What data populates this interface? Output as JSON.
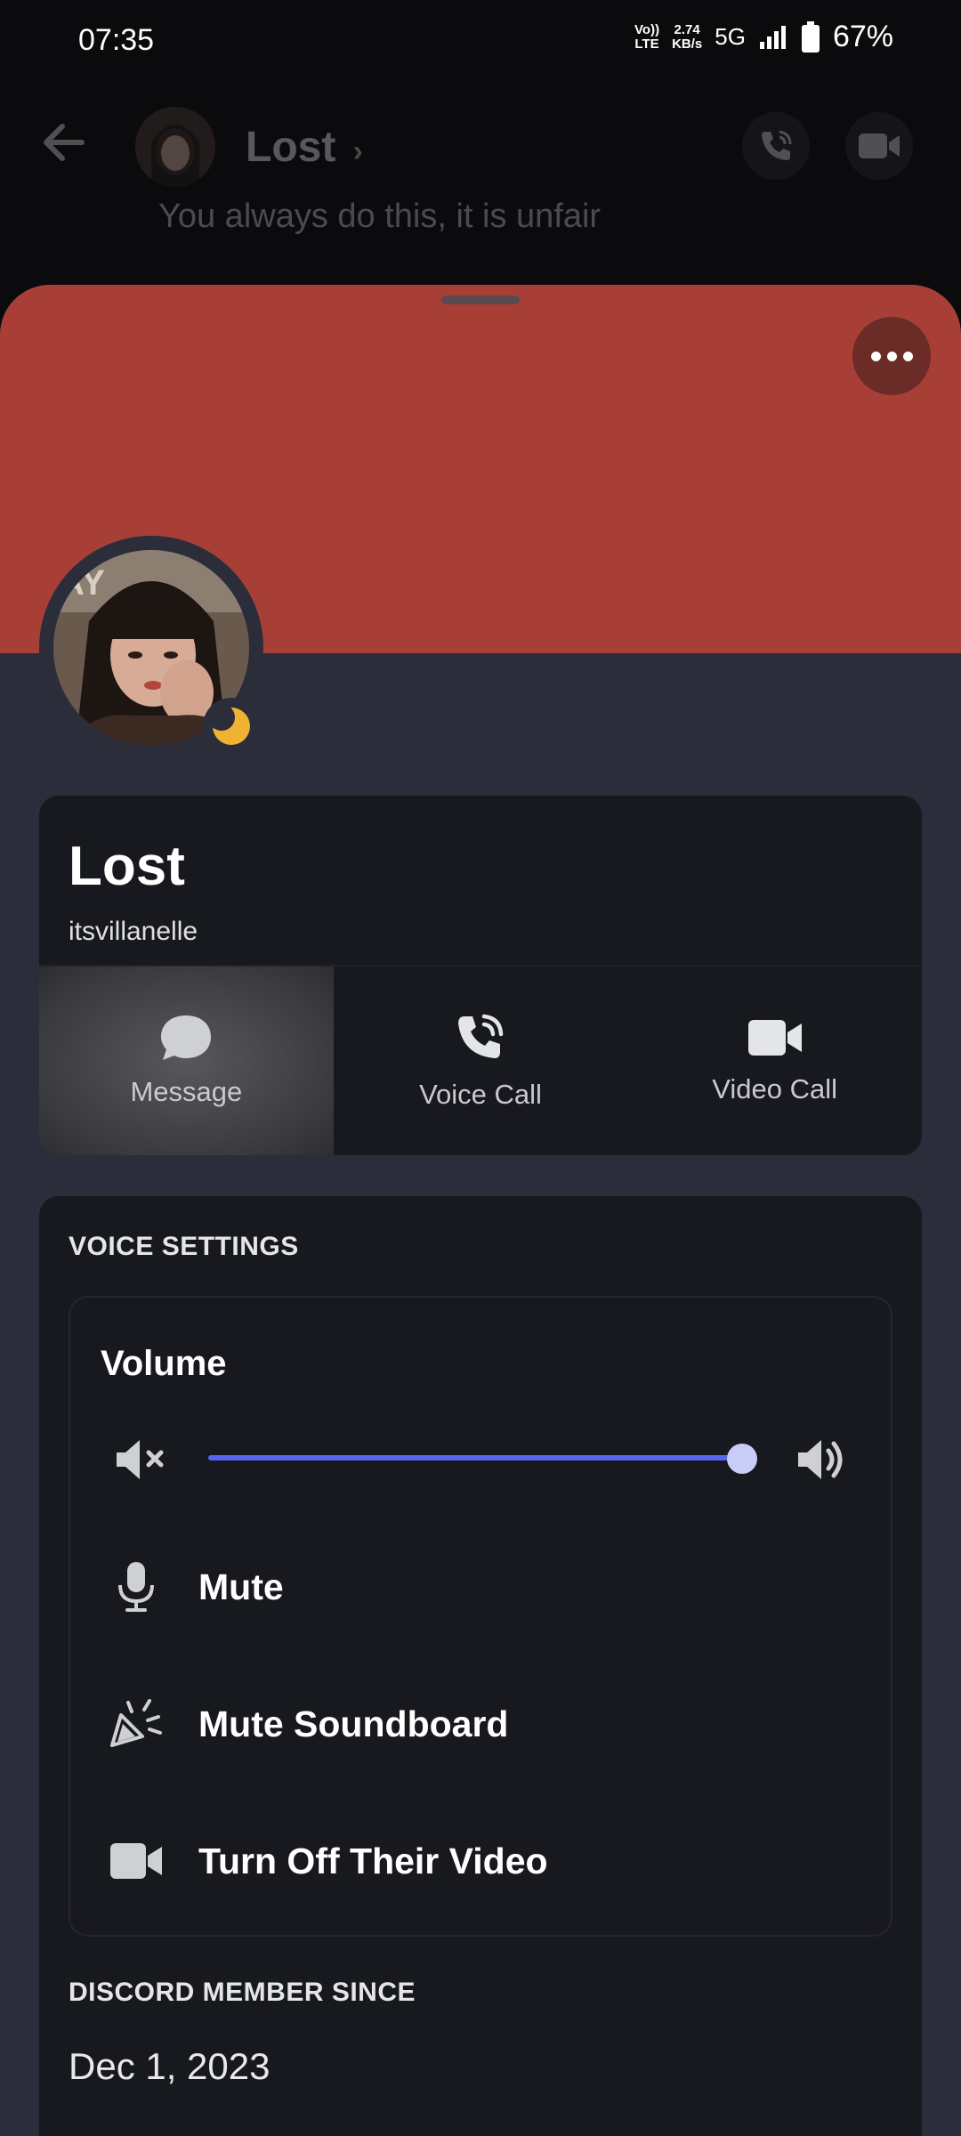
{
  "status_bar": {
    "time": "07:35",
    "volte": "Vo)) LTE",
    "speed_value": "2.74",
    "speed_unit": "KB/s",
    "network": "5G",
    "battery": "67%"
  },
  "chat_header": {
    "title": "Lost",
    "chevron": "›",
    "last_message": "You always do this, it is unfair"
  },
  "profile": {
    "display_name": "Lost",
    "username": "itsvillanelle",
    "status": "idle",
    "banner_color": "#a83f37"
  },
  "actions": [
    {
      "label": "Message",
      "icon": "chat-bubble-icon"
    },
    {
      "label": "Voice Call",
      "icon": "phone-call-icon"
    },
    {
      "label": "Video Call",
      "icon": "video-camera-icon"
    }
  ],
  "voice_settings": {
    "title": "VOICE SETTINGS",
    "volume_label": "Volume",
    "volume_level": 1.0,
    "accent_color": "#5865f2",
    "options": [
      {
        "label": "Mute",
        "icon": "microphone-icon"
      },
      {
        "label": "Mute Soundboard",
        "icon": "soundboard-icon"
      },
      {
        "label": "Turn Off Their Video",
        "icon": "video-camera-icon"
      }
    ]
  },
  "member_since": {
    "title": "DISCORD MEMBER SINCE",
    "date": "Dec 1, 2023"
  }
}
